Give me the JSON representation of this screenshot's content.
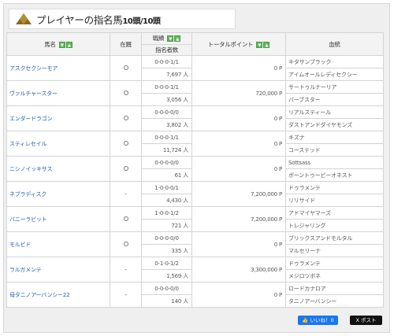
{
  "title": {
    "main": "プレイヤーの指名馬",
    "count": "10頭/10頭"
  },
  "headers": {
    "name": "馬名",
    "stable": "在厩",
    "record": "戦績",
    "nominators": "指名者数",
    "points": "トータルポイント",
    "pedigree": "血統",
    "sort_down": "▼",
    "sort_up": "▲"
  },
  "horses": [
    {
      "name": "アスクセクシーモア",
      "stable": "○",
      "record": "0-0-0-1/1",
      "nominators": "7,697 人",
      "points": "0 P",
      "sire": "キタサンブラック",
      "dam": "アイムオールレディセクシー"
    },
    {
      "name": "ヴァルチャースター",
      "stable": "○",
      "record": "0-0-0-1/1",
      "nominators": "3,056 人",
      "points": "720,000 P",
      "sire": "サートゥルナーリア",
      "dam": "バーブスター"
    },
    {
      "name": "エンダードラゴン",
      "stable": "○",
      "record": "0-0-0-0/0",
      "nominators": "3,802 人",
      "points": "0 P",
      "sire": "リアルスティール",
      "dam": "ダストアンドダイヤモンズ"
    },
    {
      "name": "スティレセイル",
      "stable": "○",
      "record": "0-0-0-1/1",
      "nominators": "11,724 人",
      "points": "0 P",
      "sire": "キズナ",
      "dam": "コーステッド"
    },
    {
      "name": "ニシノイッキサス",
      "stable": "○",
      "record": "0-0-0-0/0",
      "nominators": "61 人",
      "points": "0 P",
      "sire": "Sottsass",
      "dam": "ボーントゥービーオネスト"
    },
    {
      "name": "ネブラディスク",
      "stable": "-",
      "record": "1-0-0-0/1",
      "nominators": "4,430 人",
      "points": "7,200,000 P",
      "sire": "ドゥラメンテ",
      "dam": "リリサイド"
    },
    {
      "name": "バニーラビット",
      "stable": "○",
      "record": "1-0-0-1/2",
      "nominators": "721 人",
      "points": "7,200,000 P",
      "sire": "アドマイヤマーズ",
      "dam": "トレジャリング"
    },
    {
      "name": "モルビド",
      "stable": "○",
      "record": "0-0-0-0/0",
      "nominators": "335 人",
      "points": "0 P",
      "sire": "ブリックスアンドモルタル",
      "dam": "マルセリーナ"
    },
    {
      "name": "ラルガメンテ",
      "stable": "-",
      "record": "0-1-0-1/2",
      "nominators": "1,569 人",
      "points": "3,300,000 P",
      "sire": "ドゥラメンテ",
      "dam": "メジロツボネ"
    },
    {
      "name": "母タニノアーバンシー22",
      "stable": "-",
      "record": "0-0-0-0/0",
      "nominators": "140 人",
      "points": "0 P",
      "sire": "ロードカナロア",
      "dam": "タニノアーバンシー"
    }
  ],
  "share": {
    "like": "👍 いいね！0",
    "post": "X ポスト"
  },
  "colors": {
    "name_link": "#1a5bb0",
    "sort_button": "#5cb85c",
    "like": "#1877f2",
    "x": "#111111"
  },
  "icons": {
    "title": "mountain-triangle-icon"
  }
}
